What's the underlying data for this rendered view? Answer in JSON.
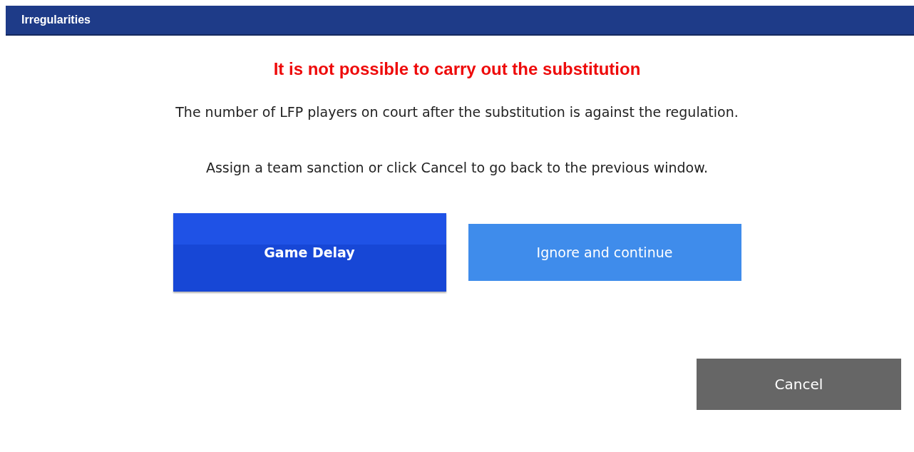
{
  "window": {
    "title": "Irregularities"
  },
  "heading": "It is not possible to carry out the substitution",
  "messages": [
    "The number of LFP players on court after the substitution is against the regulation.",
    "Assign a team sanction or click Cancel to go back to the previous window."
  ],
  "options": [
    {
      "label": "Game Delay",
      "selected": true
    },
    {
      "label": "Ignore and continue",
      "selected": false
    }
  ],
  "cancel": "Cancel"
}
